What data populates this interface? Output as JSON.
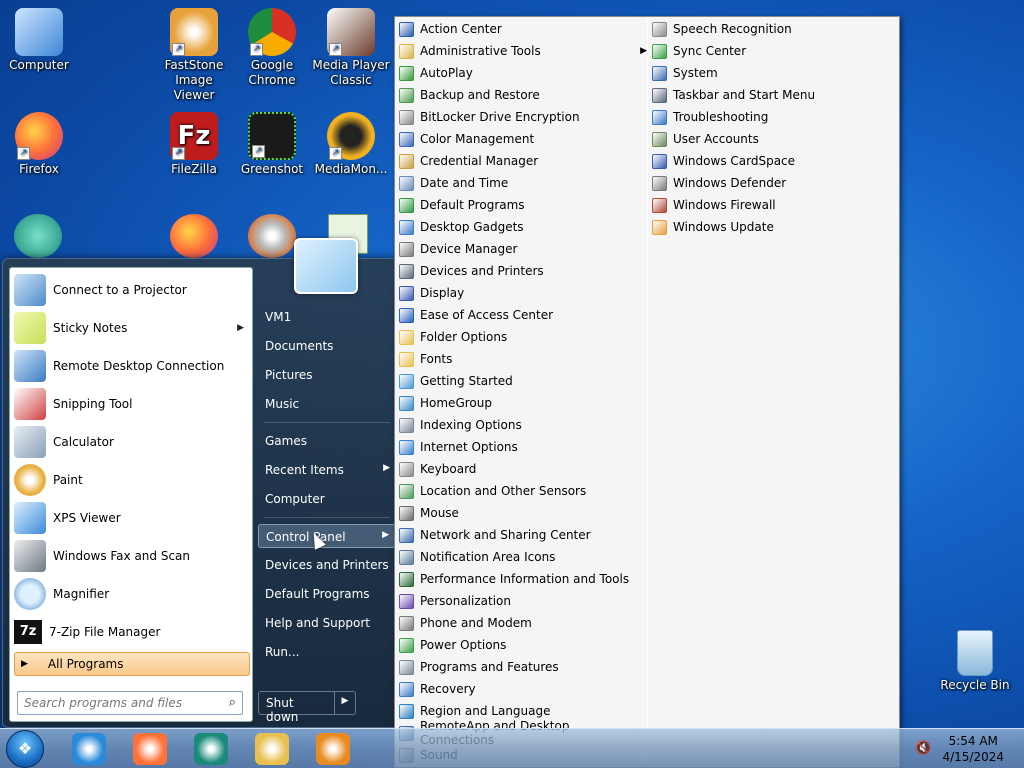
{
  "desktop": {
    "icons": [
      {
        "label": "Computer",
        "color": "#3d86d6"
      },
      {
        "label": "FastStone Image Viewer",
        "color": "#e8a23a"
      },
      {
        "label": "Google Chrome",
        "color": "#2f9e44"
      },
      {
        "label": "Media Player Classic",
        "color": "#6a3b2a"
      },
      {
        "label": "Firefox",
        "color": "#ff7139"
      },
      {
        "label": "FileZilla",
        "color": "#bf1d1d"
      },
      {
        "label": "Greenshot",
        "color": "#1b1b1b"
      },
      {
        "label": "MediaMon...",
        "color": "#f0b020"
      },
      {
        "label": "Recycle Bin",
        "color": "#b8d4ea"
      }
    ]
  },
  "start_menu": {
    "programs": [
      {
        "label": "Connect to a Projector",
        "color": "#4f8ac9",
        "has_arrow": false
      },
      {
        "label": "Sticky Notes",
        "color": "#c8e05a",
        "has_arrow": true
      },
      {
        "label": "Remote Desktop Connection",
        "color": "#3c7cc4",
        "has_arrow": false
      },
      {
        "label": "Snipping Tool",
        "color": "#d04040",
        "has_arrow": false
      },
      {
        "label": "Calculator",
        "color": "#8aa0b8",
        "has_arrow": false
      },
      {
        "label": "Paint",
        "color": "#e8b040",
        "has_arrow": false
      },
      {
        "label": "XPS Viewer",
        "color": "#3a8ad8",
        "has_arrow": false
      },
      {
        "label": "Windows Fax and Scan",
        "color": "#6c7884",
        "has_arrow": false
      },
      {
        "label": "Magnifier",
        "color": "#4a86c8",
        "has_arrow": false
      },
      {
        "label": "7-Zip File Manager",
        "color": "#111111",
        "has_arrow": false
      }
    ],
    "all_programs_label": "All Programs",
    "search_placeholder": "Search programs and files",
    "right_items": [
      {
        "label": "VM1",
        "arrow": false
      },
      {
        "label": "Documents",
        "arrow": false
      },
      {
        "label": "Pictures",
        "arrow": false
      },
      {
        "label": "Music",
        "arrow": false
      },
      {
        "label": "Games",
        "arrow": false
      },
      {
        "label": "Recent Items",
        "arrow": true
      },
      {
        "label": "Computer",
        "arrow": false
      },
      {
        "label": "Control Panel",
        "arrow": true,
        "selected": true
      },
      {
        "label": "Devices and Printers",
        "arrow": false
      },
      {
        "label": "Default Programs",
        "arrow": false
      },
      {
        "label": "Help and Support",
        "arrow": false
      },
      {
        "label": "Run...",
        "arrow": false
      }
    ],
    "shutdown_label": "Shut down"
  },
  "control_panel": {
    "col1": [
      {
        "label": "Action Center",
        "color": "#2a5db0"
      },
      {
        "label": "Administrative Tools",
        "color": "#d8b24a",
        "arrow": true
      },
      {
        "label": "AutoPlay",
        "color": "#3a9a3a"
      },
      {
        "label": "Backup and Restore",
        "color": "#4a9a4a"
      },
      {
        "label": "BitLocker Drive Encryption",
        "color": "#888888"
      },
      {
        "label": "Color Management",
        "color": "#3a6ab8"
      },
      {
        "label": "Credential Manager",
        "color": "#c8a040"
      },
      {
        "label": "Date and Time",
        "color": "#6a8ab8"
      },
      {
        "label": "Default Programs",
        "color": "#2e9a44"
      },
      {
        "label": "Desktop Gadgets",
        "color": "#3a7ac8"
      },
      {
        "label": "Device Manager",
        "color": "#7a7a7a"
      },
      {
        "label": "Devices and Printers",
        "color": "#5a6a7a"
      },
      {
        "label": "Display",
        "color": "#3a5ab0"
      },
      {
        "label": "Ease of Access Center",
        "color": "#2a60c0"
      },
      {
        "label": "Folder Options",
        "color": "#e8c050"
      },
      {
        "label": "Fonts",
        "color": "#e8c050"
      },
      {
        "label": "Getting Started",
        "color": "#4a9ad8"
      },
      {
        "label": "HomeGroup",
        "color": "#3a8ac8"
      },
      {
        "label": "Indexing Options",
        "color": "#7a8a9a"
      },
      {
        "label": "Internet Options",
        "color": "#3a80d0"
      },
      {
        "label": "Keyboard",
        "color": "#8a8a8a"
      },
      {
        "label": "Location and Other Sensors",
        "color": "#4a9a5a"
      },
      {
        "label": "Mouse",
        "color": "#6a6a6a"
      },
      {
        "label": "Network and Sharing Center",
        "color": "#3a6ab0"
      },
      {
        "label": "Notification Area Icons",
        "color": "#5a7a9a"
      },
      {
        "label": "Performance Information and Tools",
        "color": "#2a6a3a"
      },
      {
        "label": "Personalization",
        "color": "#6a4ab0"
      },
      {
        "label": "Phone and Modem",
        "color": "#7a7a7a"
      },
      {
        "label": "Power Options",
        "color": "#3aa04a"
      },
      {
        "label": "Programs and Features",
        "color": "#7a8a9a"
      },
      {
        "label": "Recovery",
        "color": "#3a7ac8"
      },
      {
        "label": "Region and Language",
        "color": "#2a80c0"
      },
      {
        "label": "RemoteApp and Desktop Connections",
        "color": "#3a6ab0"
      },
      {
        "label": "Sound",
        "color": "#7a7a7a"
      }
    ],
    "col2": [
      {
        "label": "Speech Recognition",
        "color": "#8a8a8a"
      },
      {
        "label": "Sync Center",
        "color": "#3aa04a"
      },
      {
        "label": "System",
        "color": "#3a6ab0"
      },
      {
        "label": "Taskbar and Start Menu",
        "color": "#5a6a7a"
      },
      {
        "label": "Troubleshooting",
        "color": "#3a7ac8"
      },
      {
        "label": "User Accounts",
        "color": "#6a8a5a"
      },
      {
        "label": "Windows CardSpace",
        "color": "#3a5ab0"
      },
      {
        "label": "Windows Defender",
        "color": "#7a7a7a"
      },
      {
        "label": "Windows Firewall",
        "color": "#b04a3a"
      },
      {
        "label": "Windows Update",
        "color": "#e8a040"
      }
    ]
  },
  "taskbar": {
    "pinned": [
      {
        "name": "internet-explorer",
        "color": "#2a8ad8"
      },
      {
        "name": "firefox",
        "color": "#ff7139"
      },
      {
        "name": "app",
        "color": "#1a8a7a"
      },
      {
        "name": "file-explorer",
        "color": "#e8c050"
      },
      {
        "name": "media-player",
        "color": "#e88a20"
      }
    ],
    "time": "5:54 AM",
    "date": "4/15/2024"
  }
}
